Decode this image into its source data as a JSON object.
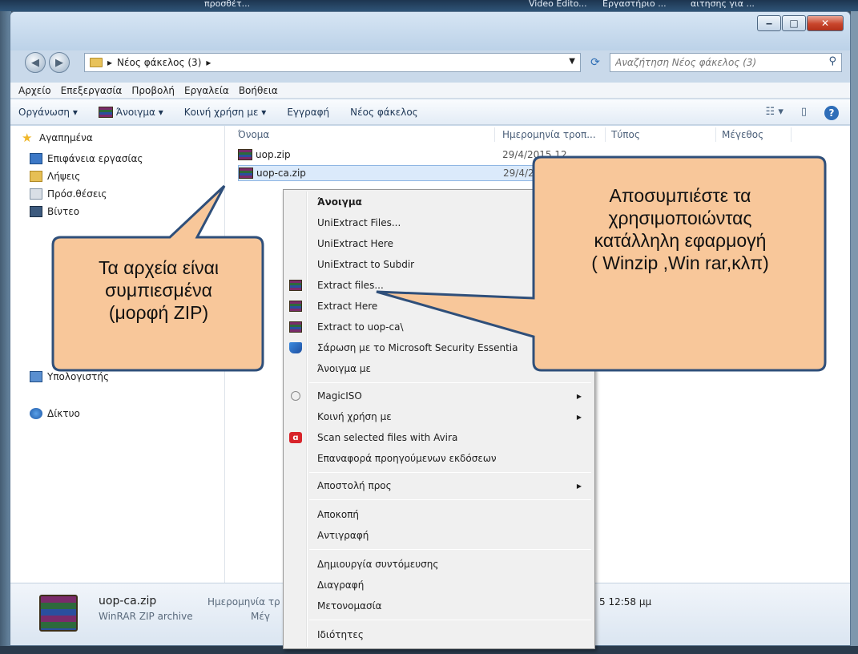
{
  "taskbar_top": [
    "προσθέτ...",
    "Video Edito...",
    "Εργαστήριο ...",
    "αιτησης για ..."
  ],
  "window": {
    "controls": {
      "minimize": "‒",
      "maximize": "□",
      "close": "✕"
    }
  },
  "address": {
    "path": "Νέος φάκελος (3)",
    "search_placeholder": "Αναζήτηση Νέος φάκελος (3)"
  },
  "menubar": [
    "Αρχείο",
    "Επεξεργασία",
    "Προβολή",
    "Εργαλεία",
    "Βοήθεια"
  ],
  "toolbar": {
    "organize": "Οργάνωση ▾",
    "open": "Άνοιγμα ▾",
    "share": "Κοινή χρήση με ▾",
    "burn": "Εγγραφή",
    "new_folder": "Νέος φάκελος"
  },
  "sidebar": {
    "favorites": "Αγαπημένα",
    "desktop": "Επιφάνεια εργασίας",
    "downloads": "Λήψεις",
    "recent": "Πρόσ.θέσεις",
    "videos": "Βίντεο",
    "computer": "Υπολογιστής",
    "network": "Δίκτυο"
  },
  "columns": {
    "name": "Όνομα",
    "date": "Ημερομηνία τροπ...",
    "type": "Τύπος",
    "size": "Μέγεθος"
  },
  "files": [
    {
      "name": "uop.zip",
      "date": "29/4/2015 12"
    },
    {
      "name": "uop-ca.zip",
      "date": "29/4/20"
    }
  ],
  "context_menu": {
    "open": "Άνοιγμα",
    "uni_files": "UniExtract Files...",
    "uni_here": "UniExtract Here",
    "uni_subdir": "UniExtract to Subdir",
    "extract_files": "Extract files...",
    "extract_here": "Extract Here",
    "extract_to": "Extract to uop-ca\\",
    "scan_mse": "Σάρωση με το Microsoft Security Essentia",
    "open_with": "Άνοιγμα με",
    "magiciso": "MagicISO",
    "share_with": "Κοινή χρήση με",
    "scan_avira": "Scan selected files with Avira",
    "restore": "Επαναφορά προηγούμενων εκδόσεων",
    "send_to": "Αποστολή προς",
    "cut": "Αποκοπή",
    "copy": "Αντιγραφή",
    "shortcut": "Δημιουργία συντόμευσης",
    "delete": "Διαγραφή",
    "rename": "Μετονομασία",
    "properties": "Ιδιότητες"
  },
  "details": {
    "filename": "uop-ca.zip",
    "filetype": "WinRAR ZIP archive",
    "date_label": "Ημερομηνία τρ",
    "size_label": "Μέγ",
    "date_value": "5 12:58 μμ"
  },
  "callouts": {
    "left": [
      "Τα αρχεία είναι",
      "συμπιεσμένα",
      "(μορφή ZIP)"
    ],
    "right": [
      "Αποσυμπιέστε τα",
      "χρησιμοποιώντας",
      "κατάλληλη εφαρμογή",
      "( Winzip ,Win rar,κλπ)"
    ]
  },
  "colors": {
    "callout_fill": "#f8c79a",
    "callout_border": "#2f4f7a",
    "selection": "#dbeafb"
  }
}
